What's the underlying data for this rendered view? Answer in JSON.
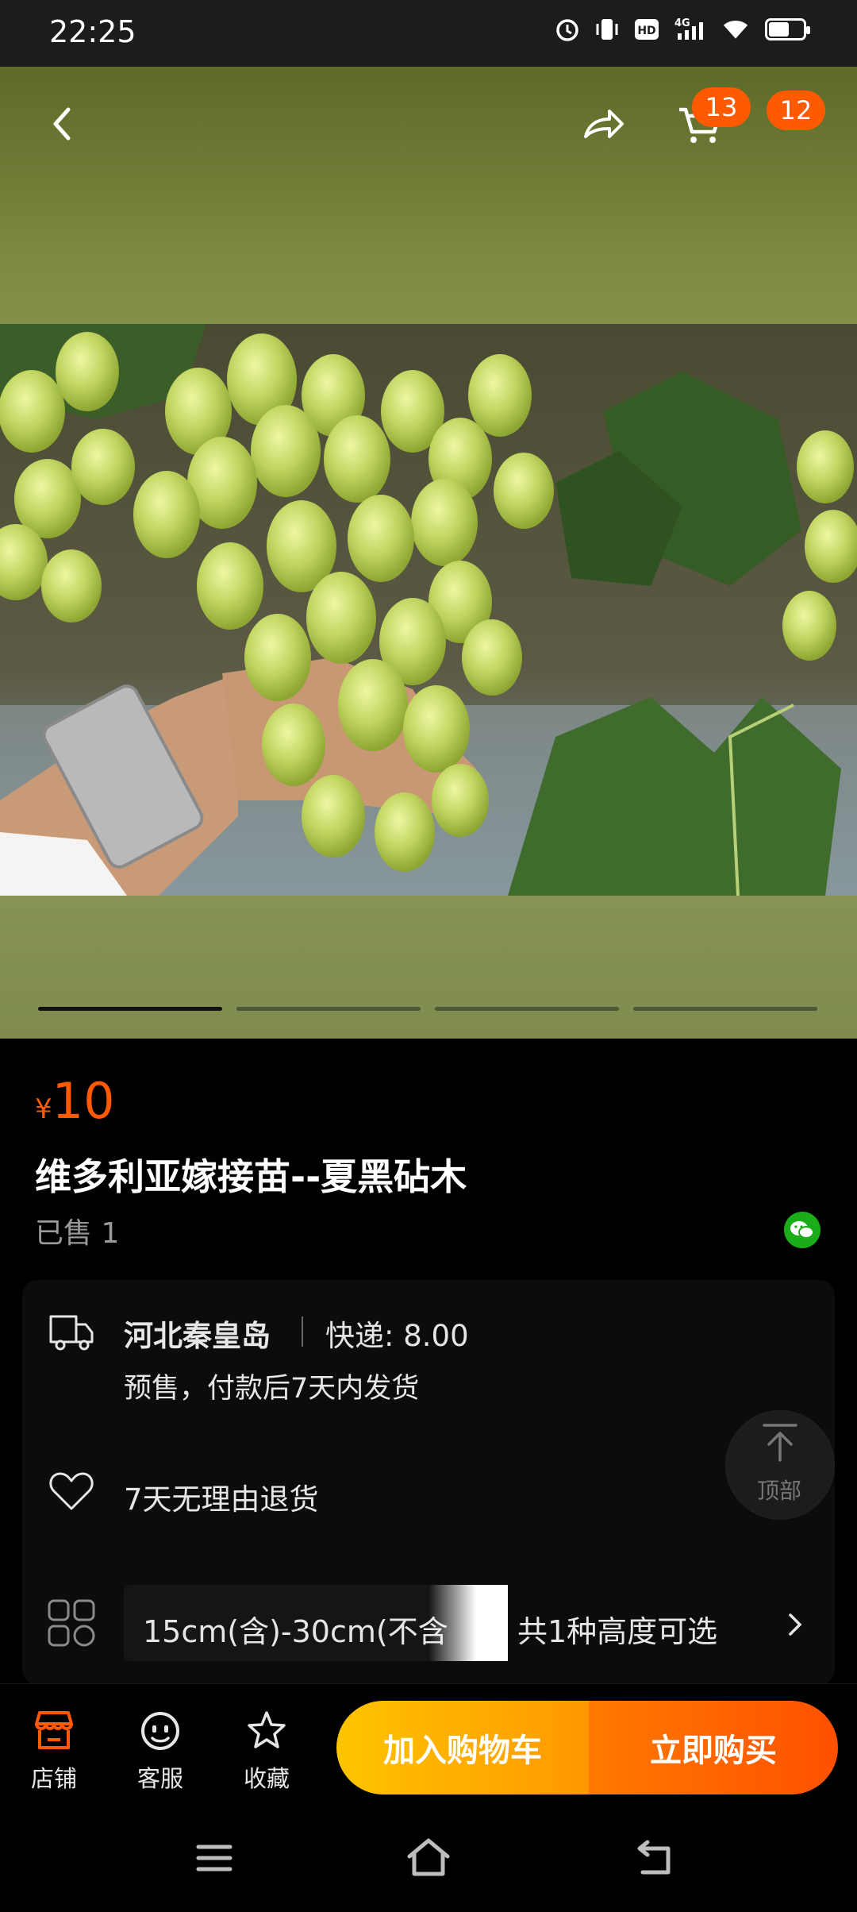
{
  "status_bar": {
    "time": "22:25",
    "network": "4G",
    "hd": "HD",
    "battery_level": 0.6
  },
  "header": {
    "cart_count": "13",
    "message_count": "12"
  },
  "gallery": {
    "image_count": 4,
    "active_index": 0
  },
  "product": {
    "currency": "¥",
    "price": "10",
    "title": "维多利亚嫁接苗--夏黑砧木",
    "sold": "已售 1"
  },
  "details": {
    "origin": "河北秦皇岛",
    "shipping": "快递: 8.00",
    "presale": "预售，付款后7天内发货",
    "returns": "7天无理由退货",
    "spec_selected": "15cm(含)-30cm(不含",
    "spec_count": "共1种高度可选"
  },
  "floating": {
    "back_to_top": "顶部"
  },
  "bottom_bar": {
    "store": "店铺",
    "service": "客服",
    "favorite": "收藏",
    "add_to_cart": "加入购物车",
    "buy_now": "立即购买"
  },
  "colors": {
    "accent": "#ff5a00",
    "yellow": "#ffc400",
    "wechat": "#1aad19"
  }
}
